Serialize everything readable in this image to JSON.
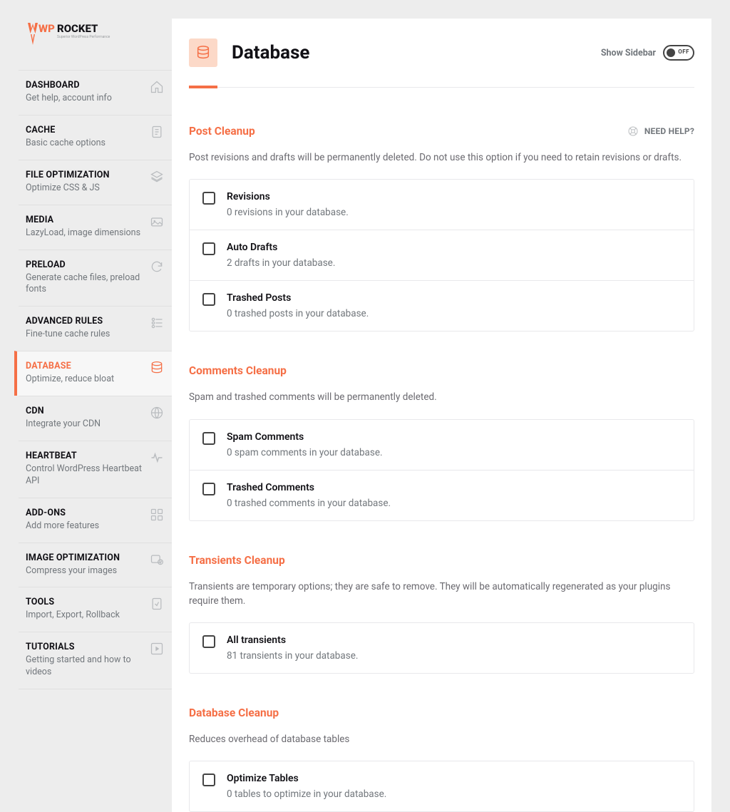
{
  "logo": {
    "word1": "WP",
    "word2": "ROCKET",
    "tagline": "Superior WordPress Performance"
  },
  "nav": [
    {
      "title": "DASHBOARD",
      "sub": "Get help, account info",
      "icon": "home"
    },
    {
      "title": "CACHE",
      "sub": "Basic cache options",
      "icon": "file"
    },
    {
      "title": "FILE OPTIMIZATION",
      "sub": "Optimize CSS & JS",
      "icon": "stack"
    },
    {
      "title": "MEDIA",
      "sub": "LazyLoad, image dimensions",
      "icon": "media"
    },
    {
      "title": "PRELOAD",
      "sub": "Generate cache files, preload fonts",
      "icon": "refresh"
    },
    {
      "title": "ADVANCED RULES",
      "sub": "Fine-tune cache rules",
      "icon": "sliders"
    },
    {
      "title": "DATABASE",
      "sub": "Optimize, reduce bloat",
      "icon": "database",
      "active": true
    },
    {
      "title": "CDN",
      "sub": "Integrate your CDN",
      "icon": "globe"
    },
    {
      "title": "HEARTBEAT",
      "sub": "Control WordPress Heartbeat API",
      "icon": "heartbeat"
    },
    {
      "title": "ADD-ONS",
      "sub": "Add more features",
      "icon": "addons"
    },
    {
      "title": "IMAGE OPTIMIZATION",
      "sub": "Compress your images",
      "icon": "imgopt"
    },
    {
      "title": "TOOLS",
      "sub": "Import, Export, Rollback",
      "icon": "tools"
    },
    {
      "title": "TUTORIALS",
      "sub": "Getting started and how to videos",
      "icon": "play"
    }
  ],
  "header": {
    "title": "Database",
    "show_sidebar": "Show Sidebar",
    "toggle_off": "OFF"
  },
  "help_label": "NEED HELP?",
  "sections": [
    {
      "title": "Post Cleanup",
      "desc": "Post revisions and drafts will be permanently deleted. Do not use this option if you need to retain revisions or drafts.",
      "help": true,
      "options": [
        {
          "title": "Revisions",
          "sub": "0 revisions in your database."
        },
        {
          "title": "Auto Drafts",
          "sub": "2 drafts in your database."
        },
        {
          "title": "Trashed Posts",
          "sub": "0 trashed posts in your database."
        }
      ]
    },
    {
      "title": "Comments Cleanup",
      "desc": "Spam and trashed comments will be permanently deleted.",
      "options": [
        {
          "title": "Spam Comments",
          "sub": "0 spam comments in your database."
        },
        {
          "title": "Trashed Comments",
          "sub": "0 trashed comments in your database."
        }
      ]
    },
    {
      "title": "Transients Cleanup",
      "desc": "Transients are temporary options; they are safe to remove. They will be automatically regenerated as your plugins require them.",
      "options": [
        {
          "title": "All transients",
          "sub": "81 transients in your database."
        }
      ]
    },
    {
      "title": "Database Cleanup",
      "desc": "Reduces overhead of database tables",
      "options": [
        {
          "title": "Optimize Tables",
          "sub": "0 tables to optimize in your database."
        }
      ]
    }
  ]
}
